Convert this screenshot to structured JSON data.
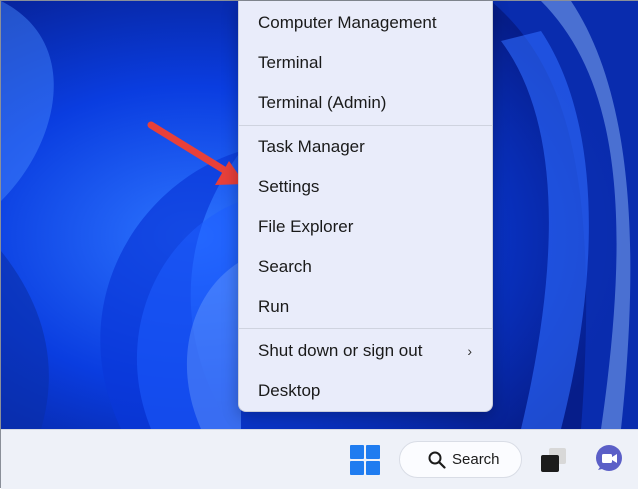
{
  "context_menu": {
    "items": [
      {
        "label": "Computer Management"
      },
      {
        "label": "Terminal"
      },
      {
        "label": "Terminal (Admin)"
      },
      {
        "label": "Task Manager"
      },
      {
        "label": "Settings"
      },
      {
        "label": "File Explorer"
      },
      {
        "label": "Search"
      },
      {
        "label": "Run"
      },
      {
        "label": "Shut down or sign out",
        "submenu_glyph": "›"
      },
      {
        "label": "Desktop"
      }
    ]
  },
  "taskbar": {
    "search_label": "Search",
    "icons": [
      "windows-start-icon",
      "search-icon",
      "task-view-icon",
      "chat-icon"
    ]
  },
  "colors": {
    "accent": "#1f7cf0",
    "arrow": "#e8403a",
    "menu_bg": "#e9ecfa"
  }
}
